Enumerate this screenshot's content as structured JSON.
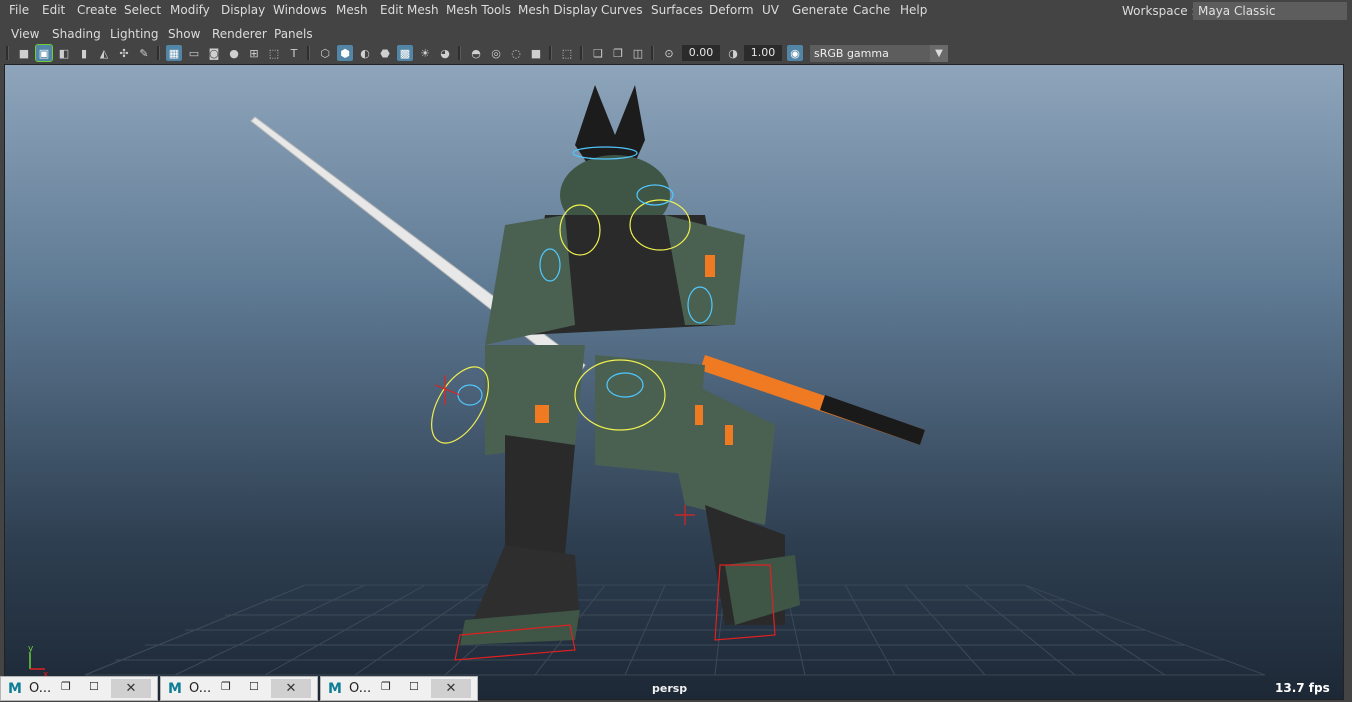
{
  "menubar": {
    "items": [
      "File",
      "Edit",
      "Create",
      "Select",
      "Modify",
      "Display",
      "Windows",
      "Mesh",
      "Edit Mesh",
      "Mesh Tools",
      "Mesh Display",
      "Curves",
      "Surfaces",
      "Deform",
      "UV",
      "Generate",
      "Cache",
      "Help"
    ],
    "workspace_label": "Workspace :",
    "workspace_value": "Maya Classic"
  },
  "panel_menu": {
    "items": [
      "View",
      "Shading",
      "Lighting",
      "Show",
      "Renderer",
      "Panels"
    ]
  },
  "toolbar": {
    "exposure": "0.00",
    "gamma": "1.00",
    "color_management": "sRGB gamma",
    "colors": {
      "accent": "#5285a6",
      "highlight": "#6ccf3a"
    }
  },
  "viewport": {
    "camera": "persp",
    "fps": "13.7 fps",
    "axis_labels": {
      "x": "x",
      "y": "y"
    },
    "colors": {
      "bg_top": "#8ea5bb",
      "bg_bottom": "#1d2836",
      "armor": "#4a6152",
      "accent": "#f07a22",
      "control_cyan": "#50c8ff",
      "control_yellow": "#f0f050",
      "control_red": "#e02020"
    }
  },
  "taskbar": {
    "items": [
      {
        "app": "M",
        "title": "O...",
        "icon": "maya-icon"
      },
      {
        "app": "M",
        "title": "O...",
        "icon": "maya-icon"
      },
      {
        "app": "M",
        "title": "O...",
        "icon": "maya-icon"
      }
    ],
    "close_glyph": "✕",
    "restore_glyph": "❐",
    "maximize_glyph": "☐"
  }
}
